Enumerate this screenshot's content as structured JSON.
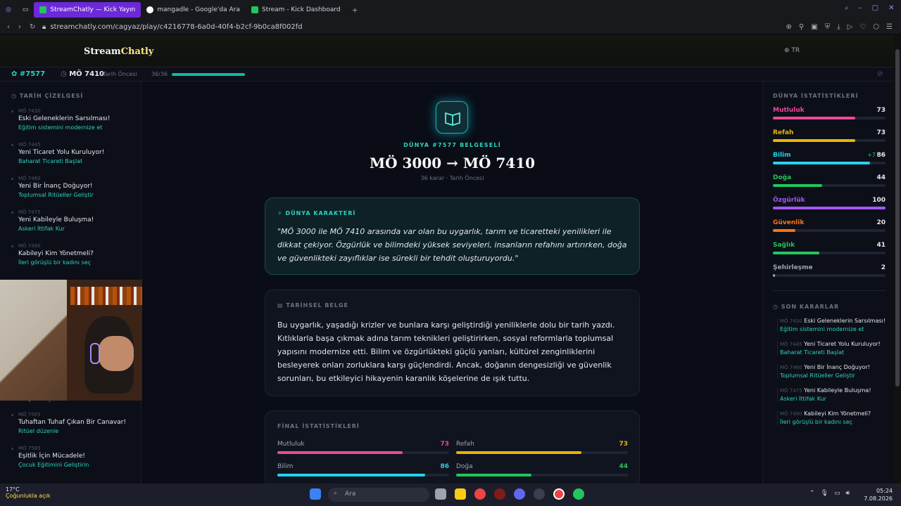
{
  "browser": {
    "tabs": [
      {
        "label": "StreamChatly — Kick Yayın",
        "color": "#22c55e"
      },
      {
        "label": "mangadle - Google'da Ara",
        "color": "#ffffff"
      },
      {
        "label": "Stream - Kick Dashboard",
        "color": "#22c55e"
      }
    ],
    "url": "streamchatly.com/cagyaz/play/c4216778-6a0d-40f4-b2cf-9b0ca8f002fd"
  },
  "site": {
    "logo_a": "Stream",
    "logo_b": "Chatly",
    "lang": "TR"
  },
  "strip": {
    "world": "#7577",
    "year": "MÖ 7410",
    "sub": "Tarih Öncesi",
    "count": "36/36",
    "progress": 1.0
  },
  "left": {
    "title": "TARİH ÇİZELGESİ",
    "items": [
      {
        "year": "MÖ 7430",
        "title": "Eski Geleneklerin Sarsılması!",
        "choice": "Eğitim sistemini modernize et"
      },
      {
        "year": "MÖ 7445",
        "title": "Yeni Ticaret Yolu Kuruluyor!",
        "choice": "Baharat Ticareti Başlat"
      },
      {
        "year": "MÖ 7460",
        "title": "Yeni Bir İnanç Doğuyor!",
        "choice": "Toplumsal Ritüeller Geliştir"
      },
      {
        "year": "MÖ 7475",
        "title": "Yeni Kabileyle Buluşma!",
        "choice": "Askeri İttifak Kur"
      },
      {
        "year": "MÖ 7490",
        "title": "Kabileyi Kim Yönetmeli?",
        "choice": "İleri görüşlü bir kadını seç"
      },
      {
        "year": "",
        "title": "",
        "choice": "Sosyal araçları icat et"
      },
      {
        "year": "MÖ 7565",
        "title": "Tuhaftan Tuhaf Çıkan Bir Canavar!",
        "choice": "Ritüel düzenle"
      },
      {
        "year": "MÖ 7585",
        "title": "Eşitlik İçin Mücadele!",
        "choice": "Çocuk Eğitimini Geliştirin"
      }
    ]
  },
  "main": {
    "kicker": "DÜNYA #7577 BELGESELİ",
    "title": "MÖ 3000 → MÖ 7410",
    "meta": "36 karar · Tarih Öncesi",
    "character_title": "DÜNYA KARAKTERİ",
    "character_text": "\"MÖ 3000 ile MÖ 7410 arasında var olan bu uygarlık, tarım ve ticaretteki yenilikleri ile dikkat çekiyor. Özgürlük ve bilimdeki yüksek seviyeleri, insanların refahını artırırken, doğa ve güvenlikteki zayıflıklar ise sürekli bir tehdit oluşturuyordu.\"",
    "doc_title": "TARİHSEL BELGE",
    "doc_text": "Bu uygarlık, yaşadığı krizler ve bunlara karşı geliştirdiği yeniliklerle dolu bir tarih yazdı. Kıtlıklarla başa çıkmak adına tarım teknikleri geliştirirken, sosyal reformlarla toplumsal yapısını modernize etti. Bilim ve özgürlükteki güçlü yanları, kültürel zenginliklerini besleyerek onları zorluklara karşı güçlendirdi. Ancak, doğanın dengesizliği ve güvenlik sorunları, bu etkileyici hikayenin karanlık köşelerine de ışık tuttu.",
    "final_title": "FİNAL İSTATİSTİKLERİ",
    "final_stats": [
      {
        "label": "Mutluluk",
        "value": 73,
        "color": "#ec4899"
      },
      {
        "label": "Refah",
        "value": 73,
        "color": "#eab308"
      },
      {
        "label": "Bilim",
        "value": 86,
        "color": "#22d3ee"
      },
      {
        "label": "Doğa",
        "value": 44,
        "color": "#22c55e"
      }
    ]
  },
  "right": {
    "title": "DÜNYA İSTATİSTİKLERİ",
    "stats": [
      {
        "label": "Mutluluk",
        "value": 73,
        "delta": "",
        "color": "#ec4899"
      },
      {
        "label": "Refah",
        "value": 73,
        "delta": "",
        "color": "#eab308"
      },
      {
        "label": "Bilim",
        "value": 86,
        "delta": "+7",
        "color": "#22d3ee"
      },
      {
        "label": "Doğa",
        "value": 44,
        "delta": "",
        "color": "#22c55e"
      },
      {
        "label": "Özgürlük",
        "value": 100,
        "delta": "",
        "color": "#a855f7"
      },
      {
        "label": "Güvenlik",
        "value": 20,
        "delta": "",
        "color": "#f97316"
      },
      {
        "label": "Sağlık",
        "value": 41,
        "delta": "",
        "color": "#22c55e"
      },
      {
        "label": "Şehirleşme",
        "value": 2,
        "delta": "",
        "color": "#9ca3af"
      }
    ],
    "decisions_title": "SON KARARLAR",
    "decisions": [
      {
        "year": "MÖ 7430",
        "title": "Eski Geleneklerin Sarsılması!",
        "choice": "Eğitim sistemini modernize et"
      },
      {
        "year": "MÖ 7445",
        "title": "Yeni Ticaret Yolu Kuruluyor!",
        "choice": "Baharat Ticareti Başlat"
      },
      {
        "year": "MÖ 7460",
        "title": "Yeni Bir İnanç Doğuyor!",
        "choice": "Toplumsal Ritüeller Geliştir"
      },
      {
        "year": "MÖ 7475",
        "title": "Yeni Kabileyle Buluşma!",
        "choice": "Askeri İttifak Kur"
      },
      {
        "year": "MÖ 7490",
        "title": "Kabileyi Kim Yönetmeli?",
        "choice": "İleri görüşlü bir kadını seç"
      }
    ]
  },
  "taskbar": {
    "temp": "17°C",
    "weather": "Çoğunlukla açık",
    "search": "Ara",
    "time": "05:24",
    "date": "7.08.2026"
  }
}
